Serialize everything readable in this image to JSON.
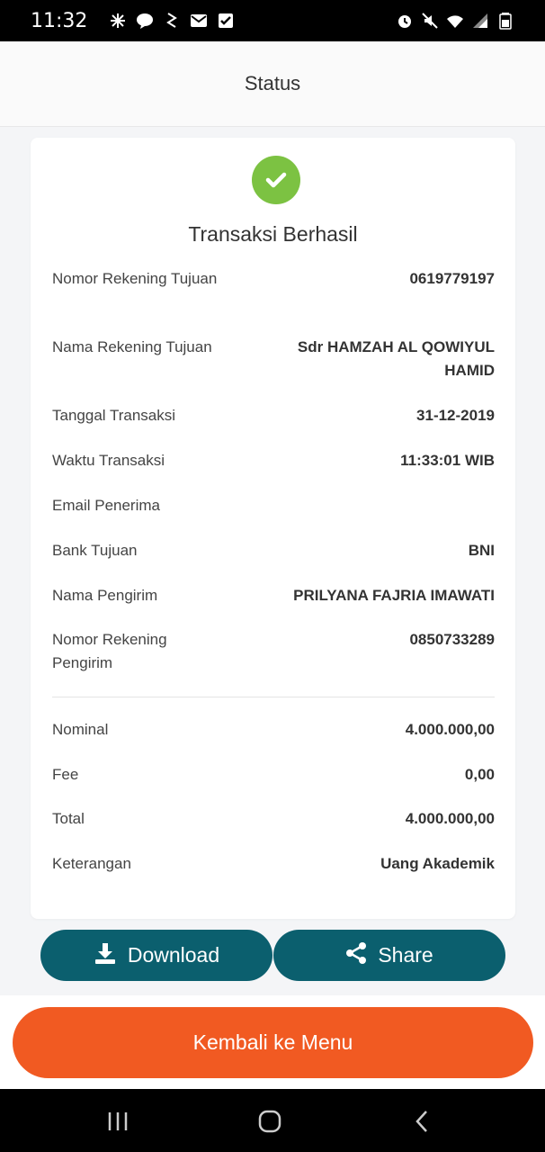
{
  "status_bar": {
    "time": "11:32"
  },
  "header": {
    "title": "Status"
  },
  "card": {
    "title": "Transaksi Berhasil",
    "details": [
      {
        "label": "Nomor Rekening Tujuan",
        "value": "0619779197"
      },
      {
        "label": "Nama Rekening Tujuan",
        "value": "Sdr HAMZAH AL QOWIYUL HAMID"
      },
      {
        "label": "Tanggal Transaksi",
        "value": "31-12-2019"
      },
      {
        "label": "Waktu Transaksi",
        "value": "11:33:01 WIB"
      },
      {
        "label": "Email Penerima",
        "value": ""
      },
      {
        "label": "Bank Tujuan",
        "value": "BNI"
      },
      {
        "label": "Nama Pengirim",
        "value": "PRILYANA FAJRIA IMAWATI"
      },
      {
        "label": "Nomor Rekening Pengirim",
        "value": "0850733289"
      }
    ],
    "summary": [
      {
        "label": "Nominal",
        "value": "4.000.000,00"
      },
      {
        "label": "Fee",
        "value": "0,00"
      },
      {
        "label": "Total",
        "value": "4.000.000,00"
      },
      {
        "label": "Keterangan",
        "value": "Uang Akademik"
      }
    ]
  },
  "actions": {
    "download_label": "Download",
    "share_label": "Share",
    "menu_label": "Kembali ke Menu"
  },
  "colors": {
    "success": "#7cc242",
    "action_teal": "#0b5f6e",
    "primary_orange": "#f15a22"
  },
  "icons": {
    "success": "check-circle-icon",
    "download": "download-icon",
    "share": "share-icon"
  }
}
